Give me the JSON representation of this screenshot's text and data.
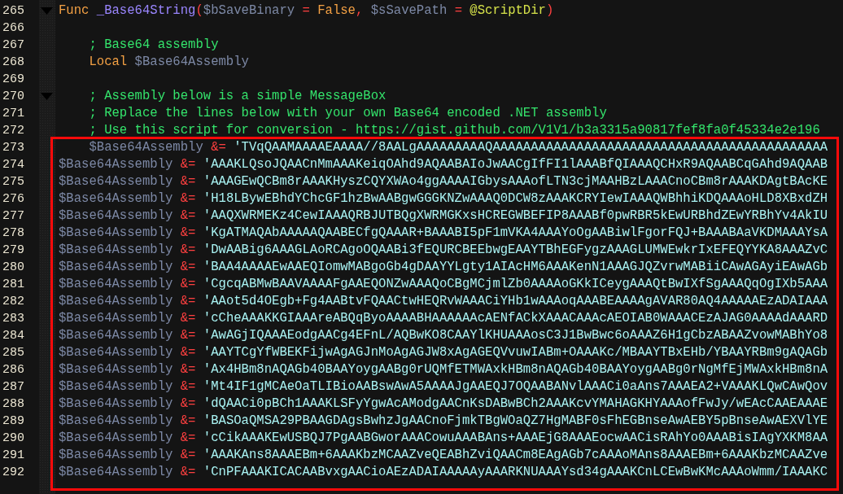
{
  "editor": {
    "lines": [
      {
        "number": "265",
        "fold_point": true,
        "tokens": [
          {
            "kind": "keyword",
            "text": "Func "
          },
          {
            "kind": "function",
            "text": "_Base64String"
          },
          {
            "kind": "operator",
            "text": "("
          },
          {
            "kind": "variable",
            "text": "$bSaveBinary "
          },
          {
            "kind": "operator",
            "text": "= "
          },
          {
            "kind": "keyword",
            "text": "False"
          },
          {
            "kind": "operator",
            "text": ", "
          },
          {
            "kind": "variable",
            "text": "$sSavePath "
          },
          {
            "kind": "operator",
            "text": "= "
          },
          {
            "kind": "macro",
            "text": "@ScriptDir"
          },
          {
            "kind": "operator",
            "text": ")"
          }
        ]
      },
      {
        "number": "266",
        "fold_point": false
      },
      {
        "number": "267",
        "fold_point": false,
        "tokens": [
          {
            "kind": "comment",
            "text": "    ; Base64 assembly"
          }
        ]
      },
      {
        "number": "268",
        "fold_point": false,
        "tokens": [
          {
            "kind": "keyword",
            "text": "    Local "
          },
          {
            "kind": "variable",
            "text": "$Base64Assembly"
          }
        ]
      },
      {
        "number": "269",
        "fold_point": false
      },
      {
        "number": "270",
        "fold_point": true,
        "tokens": [
          {
            "kind": "comment",
            "text": "    ; Assembly below is a simple MessageBox"
          }
        ]
      },
      {
        "number": "271",
        "fold_point": false,
        "tokens": [
          {
            "kind": "comment",
            "text": "    ; Replace the lines below with your own Base64 encoded .NET assembly"
          }
        ]
      },
      {
        "number": "272",
        "fold_point": false,
        "tokens": [
          {
            "kind": "comment",
            "text": "    ; Use this script for conversion - https://gist.github.com/V1V1/b3a3315a90817fef8fa0f45334e2e196"
          }
        ]
      }
    ],
    "boxed_lines": [
      {
        "number": "273",
        "fold_point": false,
        "tokens": [
          {
            "kind": "variable",
            "text": "    $Base64Assembly "
          },
          {
            "kind": "operator",
            "text": "&= "
          },
          {
            "kind": "string",
            "text": "'TVqQAAMAAAAEAAAA//8AALgAAAAAAAAAQAAAAAAAAAAAAAAAAAAAAAAAAAAAAAAAAAAAAAAAAAAAA"
          }
        ]
      },
      {
        "number": "274",
        "fold_point": false,
        "tokens": [
          {
            "kind": "variable",
            "text": "$Base64Assembly "
          },
          {
            "kind": "operator",
            "text": "&= "
          },
          {
            "kind": "string",
            "text": "'AAAKLQsoJQAACnMmAAAKeiqOAhd9AQAABAIoJwAACgIfFI1lAAABfQIAAAQCHxR9AQAABCqGAhd9AQAAB"
          }
        ]
      },
      {
        "number": "275",
        "fold_point": false,
        "tokens": [
          {
            "kind": "variable",
            "text": "$Base64Assembly "
          },
          {
            "kind": "operator",
            "text": "&= "
          },
          {
            "kind": "string",
            "text": "'AAAGEwQCBm8rAAAKHyszCQYXWAo4ggAAAAIGbysAAAofLTN3cjMAAHBzLAAACnoCBm8rAAAKDAgtBAcKE"
          }
        ]
      },
      {
        "number": "276",
        "fold_point": false,
        "tokens": [
          {
            "kind": "variable",
            "text": "$Base64Assembly "
          },
          {
            "kind": "operator",
            "text": "&= "
          },
          {
            "kind": "string",
            "text": "'H18LBywEBhdYChcGF1hzBwAABgwGGGKNZwAAAQ0DCW8zAAAKCRYIewIAAAQWBhhiKDQAAAoHLD8XBxdZH"
          }
        ]
      },
      {
        "number": "277",
        "fold_point": false,
        "tokens": [
          {
            "kind": "variable",
            "text": "$Base64Assembly "
          },
          {
            "kind": "operator",
            "text": "&= "
          },
          {
            "kind": "string",
            "text": "'AAQXWRMEKz4CewIAAAQRBJUTBQgXWRMGKxsHCREGWBEFIP8AAABf0pwRBR5kEwURBhdZEwYRBhYv4AkIU"
          }
        ]
      },
      {
        "number": "278",
        "fold_point": false,
        "tokens": [
          {
            "kind": "variable",
            "text": "$Base64Assembly "
          },
          {
            "kind": "operator",
            "text": "&= "
          },
          {
            "kind": "string",
            "text": "'KgATMAQAbAAAAAQAABECfgQAAAR+BAAABI5pF1mVKA4AAAYoOgAABiwlFgorFQJ+BAAABAaVKDMAAAYsA"
          }
        ]
      },
      {
        "number": "279",
        "fold_point": false,
        "tokens": [
          {
            "kind": "variable",
            "text": "$Base64Assembly "
          },
          {
            "kind": "operator",
            "text": "&= "
          },
          {
            "kind": "string",
            "text": "'DwAABig6AAAGLAoRCAgoOQAABi3fEQURCBEEbwgEAAYTBhEGFygzAAAGLUMWEwkrIxEFEQYYKA8AAAZvC"
          }
        ]
      },
      {
        "number": "280",
        "fold_point": false,
        "tokens": [
          {
            "kind": "variable",
            "text": "$Base64Assembly "
          },
          {
            "kind": "operator",
            "text": "&= "
          },
          {
            "kind": "string",
            "text": "'BAA4AAAAEwAAEQIomwMABgoGb4gDAAYYLgty1AIAcHM6AAAKenN1AAAGJQZvrwMABiiCAwAGAyiEAwAGb"
          }
        ]
      },
      {
        "number": "281",
        "fold_point": false,
        "tokens": [
          {
            "kind": "variable",
            "text": "$Base64Assembly "
          },
          {
            "kind": "operator",
            "text": "&= "
          },
          {
            "kind": "string",
            "text": "'CgcqABMwBAAVAAAAFgAAEQONZwAAAQoCBgMCjmlZb0AAAAoGKkICeygAAAQtBwIXfSgAAAQqOgIXb5AAA"
          }
        ]
      },
      {
        "number": "282",
        "fold_point": false,
        "tokens": [
          {
            "kind": "variable",
            "text": "$Base64Assembly "
          },
          {
            "kind": "operator",
            "text": "&= "
          },
          {
            "kind": "string",
            "text": "'AAot5d4OEgb+Fg4AABtvFQAACtwHEQRvWAAACiYHb1wAAAoqAAABEAAAAgAVAR80AQ4AAAAAEzADAIAAA"
          }
        ]
      },
      {
        "number": "283",
        "fold_point": false,
        "tokens": [
          {
            "kind": "variable",
            "text": "$Base64Assembly "
          },
          {
            "kind": "operator",
            "text": "&= "
          },
          {
            "kind": "string",
            "text": "'cCheAAAKKGIAAAreABQqByoAAAABHAAAAAAcAENfACkXAAACAAAcAEOIAB0WAAACEzAJAG0AAAAdAAARD"
          }
        ]
      },
      {
        "number": "284",
        "fold_point": false,
        "tokens": [
          {
            "kind": "variable",
            "text": "$Base64Assembly "
          },
          {
            "kind": "operator",
            "text": "&= "
          },
          {
            "kind": "string",
            "text": "'AwAGjIQAAAEodgAACg4EFnL/AQBwKO8CAAYlKHUAAAosC3J1BwBwc6oAAAZ6H1gCbzABAAZvowMABhYo8"
          }
        ]
      },
      {
        "number": "285",
        "fold_point": false,
        "tokens": [
          {
            "kind": "variable",
            "text": "$Base64Assembly "
          },
          {
            "kind": "operator",
            "text": "&= "
          },
          {
            "kind": "string",
            "text": "'AAYTCgYfWBEKFijwAgAGJnMoAgAGJW8xAgAGEQVvuwIABm+OAAAKc/MBAAYTBxEHb/YBAAYRBm9gAQAGb"
          }
        ]
      },
      {
        "number": "286",
        "fold_point": false,
        "tokens": [
          {
            "kind": "variable",
            "text": "$Base64Assembly "
          },
          {
            "kind": "operator",
            "text": "&= "
          },
          {
            "kind": "string",
            "text": "'Ax4HBm8nAQAGb40BAAYoygAABg0rUQMfETMWAxkHBm8nAQAGb40BAAYoygAABg0rNgMfEjMWAxkHBm8nA"
          }
        ]
      },
      {
        "number": "287",
        "fold_point": false,
        "tokens": [
          {
            "kind": "variable",
            "text": "$Base64Assembly "
          },
          {
            "kind": "operator",
            "text": "&= "
          },
          {
            "kind": "string",
            "text": "'Mt4IF1gMCAeOaTLIBioAABswAwA5AAAAJgAAEQJ7OQAABANvlAAACi0aAns7AAAEA2+VAAAKLQwCAwQov"
          }
        ]
      },
      {
        "number": "288",
        "fold_point": false,
        "tokens": [
          {
            "kind": "variable",
            "text": "$Base64Assembly "
          },
          {
            "kind": "operator",
            "text": "&= "
          },
          {
            "kind": "string",
            "text": "'dQAACi0pBCh1AAAKLSFyYgwAcAModgAACnKsDABwBCh2AAAKcvYMAHAGKHYAAAofFwJy/wEAcCAAEAAAE"
          }
        ]
      },
      {
        "number": "289",
        "fold_point": false,
        "tokens": [
          {
            "kind": "variable",
            "text": "$Base64Assembly "
          },
          {
            "kind": "operator",
            "text": "&= "
          },
          {
            "kind": "string",
            "text": "'BASOaQMSA29PBAAGDAgsBwhzJgAACnoFjmkTBgWOaQZ7HgMABF0sFhEGBnseAwAEBY5pBnseAwAEXVlYE"
          }
        ]
      },
      {
        "number": "290",
        "fold_point": false,
        "tokens": [
          {
            "kind": "variable",
            "text": "$Base64Assembly "
          },
          {
            "kind": "operator",
            "text": "&= "
          },
          {
            "kind": "string",
            "text": "'cCikAAAKEwUSBQJ7PgAABGworAAACowuAAABAns+AAAEjG8AAAEocwAACisRAhYo0AAABisIAgYXKM8AA"
          }
        ]
      },
      {
        "number": "291",
        "fold_point": false,
        "tokens": [
          {
            "kind": "variable",
            "text": "$Base64Assembly "
          },
          {
            "kind": "operator",
            "text": "&= "
          },
          {
            "kind": "string",
            "text": "'AAAKAns8AAAEBm+6AAAKbzMCAAZveQEABhZviQAACm8EAgAGb7cAAAoMAns8AAAEBm+6AAAKbzMCAAZve"
          }
        ]
      },
      {
        "number": "292",
        "fold_point": false,
        "tokens": [
          {
            "kind": "variable",
            "text": "$Base64Assembly "
          },
          {
            "kind": "operator",
            "text": "&= "
          },
          {
            "kind": "string",
            "text": "'CnPFAAAKICACAABvxgAACioAEzADAIAAAAAyAAARKNUAAAYsd34gAAAKCnLCEwBwKMcAAAoWmm/IAAAKC"
          }
        ]
      }
    ]
  }
}
